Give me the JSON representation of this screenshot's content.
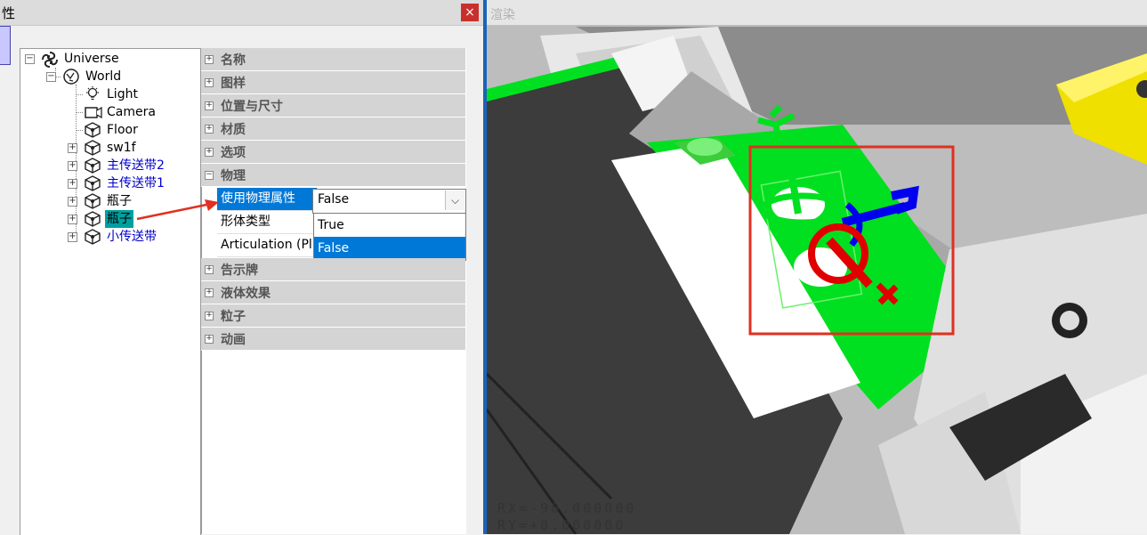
{
  "left_window": {
    "title": "性",
    "close_icon": "×"
  },
  "tree": {
    "items": [
      {
        "label": "Universe",
        "icon": "universe-icon"
      },
      {
        "label": "World",
        "icon": "world-icon"
      },
      {
        "label": "Light",
        "icon": "light-bulb-icon"
      },
      {
        "label": "Camera",
        "icon": "camera-icon"
      },
      {
        "label": "Floor",
        "icon": "object-icon"
      },
      {
        "label": "sw1f",
        "icon": "object-icon"
      },
      {
        "label": "主传送带2",
        "icon": "object-icon"
      },
      {
        "label": "主传送带1",
        "icon": "object-icon"
      },
      {
        "label": "瓶子",
        "icon": "object-icon"
      },
      {
        "label": "瓶子",
        "icon": "object-icon",
        "selected": true
      },
      {
        "label": "小传送带",
        "icon": "object-icon"
      }
    ]
  },
  "property_grid": {
    "categories_top": [
      "名称",
      "图样",
      "位置与尺寸",
      "材质",
      "选项",
      "物理"
    ],
    "physics_rows": [
      {
        "name": "使用物理属性",
        "value": "False"
      },
      {
        "name": "形体类型"
      },
      {
        "name": "Articulation (Pl"
      }
    ],
    "categories_bottom": [
      "告示牌",
      "液体效果",
      "粒子",
      "动画"
    ],
    "dropdown_options": [
      "True",
      "False"
    ],
    "selected_option": "False"
  },
  "render": {
    "title": "渲染",
    "rx": "RX=-90.000000",
    "ry": "RY=+0.000000"
  },
  "colors": {
    "selection": "#0078d7",
    "highlight_teal": "#00a0a0",
    "annotation_red": "#e03020",
    "conveyor_green": "#00e020"
  }
}
